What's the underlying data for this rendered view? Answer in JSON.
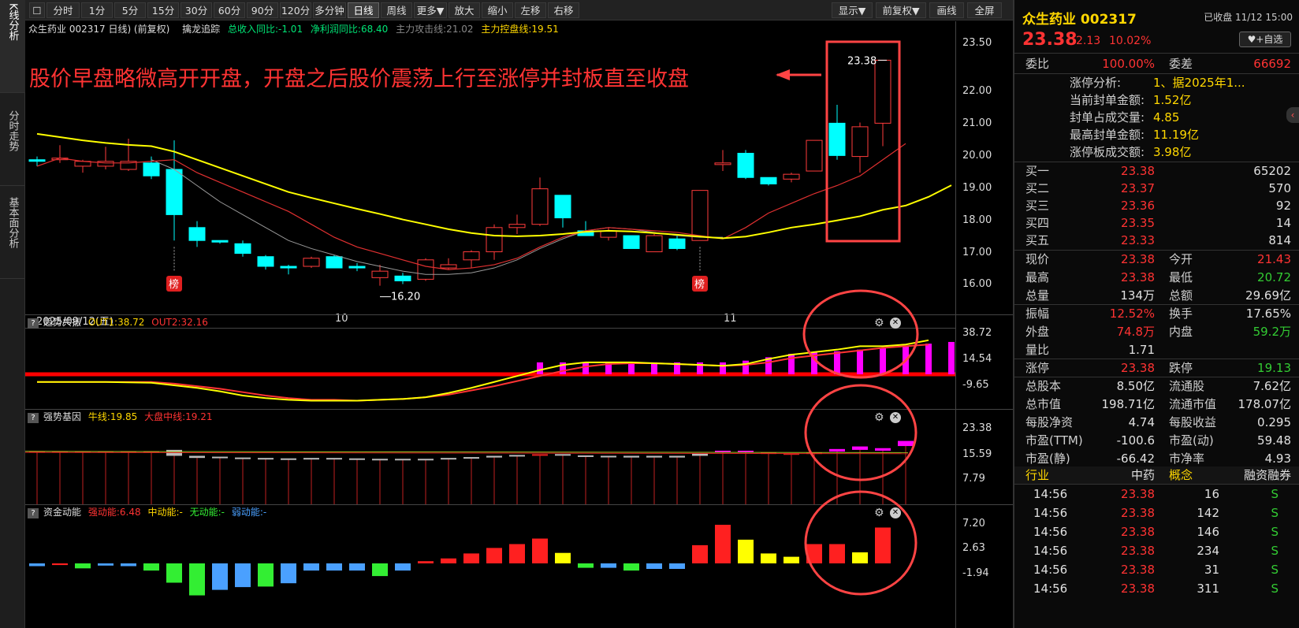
{
  "sidebar": {
    "tabs": [
      "K线分析",
      "分时走势",
      "基本面分析"
    ]
  },
  "toolbar": {
    "checkbox": "☐",
    "periods": [
      "分时",
      "1分",
      "5分",
      "15分",
      "30分",
      "60分",
      "90分",
      "120分",
      "多分钟",
      "日线",
      "周线",
      "更多▼"
    ],
    "actions": [
      "放大",
      "缩小",
      "左移",
      "右移"
    ],
    "right": [
      "显示▼",
      "前复权▼",
      "画线",
      "全屏"
    ],
    "active": "日线"
  },
  "info": {
    "stock": "众生药业 002317 日线) (前复权)",
    "tool": "擒龙追踪",
    "items": [
      {
        "t": "总收入同比:-1.01",
        "c": "#00e676"
      },
      {
        "t": "净利润同比:68.40",
        "c": "#00e676"
      },
      {
        "t": "主力攻击线:21.02",
        "c": "#888888"
      },
      {
        "t": "主力控盘线:19.51",
        "c": "#ffd700"
      }
    ]
  },
  "annotation": "股价早盘略微高开开盘，开盘之后股价震荡上行至涨停并封板直至收盘",
  "date_label": "2025/09/12(五)",
  "month_labels": [
    "10",
    "11"
  ],
  "badge": "榜",
  "price_axis": [
    "23.50",
    "22.00",
    "21.00",
    "20.00",
    "19.00",
    "18.00",
    "17.00",
    "16.00"
  ],
  "chart_data": {
    "type": "candlestick",
    "ylim": [
      16.0,
      23.5
    ],
    "high_label": "23.38",
    "low_label": "16.20",
    "candles": [
      [
        20.3,
        20.4,
        20.1,
        20.25
      ],
      [
        20.3,
        20.75,
        20.2,
        20.35
      ],
      [
        20.1,
        20.3,
        19.9,
        20.25
      ],
      [
        20.1,
        20.7,
        20.0,
        20.25
      ],
      [
        20.0,
        20.95,
        19.95,
        20.25
      ],
      [
        20.2,
        20.4,
        19.7,
        19.8
      ],
      [
        20.0,
        20.9,
        17.8,
        18.6
      ],
      [
        18.2,
        18.4,
        17.6,
        17.8
      ],
      [
        17.8,
        17.8,
        17.7,
        17.75
      ],
      [
        17.7,
        17.8,
        17.3,
        17.4
      ],
      [
        17.3,
        17.35,
        16.9,
        17.0
      ],
      [
        17.0,
        17.05,
        16.75,
        16.95
      ],
      [
        17.0,
        17.3,
        16.95,
        17.25
      ],
      [
        17.3,
        17.35,
        16.95,
        16.95
      ],
      [
        17.0,
        17.1,
        16.85,
        16.95
      ],
      [
        16.65,
        17.05,
        16.4,
        16.85
      ],
      [
        16.7,
        16.8,
        16.45,
        16.55
      ],
      [
        16.6,
        17.25,
        16.55,
        17.2
      ],
      [
        16.95,
        17.25,
        16.9,
        17.05
      ],
      [
        17.2,
        17.5,
        16.95,
        17.45
      ],
      [
        17.45,
        18.3,
        17.2,
        18.2
      ],
      [
        18.2,
        18.6,
        18.0,
        18.3
      ],
      [
        18.3,
        19.75,
        18.25,
        19.4
      ],
      [
        19.2,
        19.2,
        18.2,
        18.5
      ],
      [
        18.1,
        18.4,
        17.95,
        17.95
      ],
      [
        17.9,
        18.2,
        17.8,
        18.1
      ],
      [
        17.95,
        17.95,
        17.55,
        17.55
      ],
      [
        17.45,
        18.0,
        17.45,
        17.95
      ],
      [
        17.85,
        17.95,
        17.5,
        17.55
      ],
      [
        17.8,
        19.35,
        17.8,
        19.35
      ],
      [
        20.15,
        20.6,
        19.95,
        20.2
      ],
      [
        20.5,
        20.6,
        19.7,
        19.75
      ],
      [
        19.75,
        19.75,
        19.5,
        19.55
      ],
      [
        19.7,
        19.9,
        19.6,
        19.85
      ],
      [
        19.95,
        20.9,
        19.95,
        20.9
      ],
      [
        21.43,
        22.0,
        20.3,
        20.43
      ],
      [
        20.4,
        21.45,
        19.9,
        21.32
      ],
      [
        21.43,
        23.38,
        20.72,
        23.38
      ]
    ],
    "ma_red": [
      20.1,
      20.35,
      20.25,
      20.2,
      20.2,
      20.25,
      20.3,
      19.9,
      19.6,
      19.3,
      19.0,
      18.7,
      18.3,
      17.9,
      17.6,
      17.4,
      17.2,
      17.0,
      16.9,
      16.95,
      17.05,
      17.25,
      17.6,
      17.9,
      18.1,
      18.2,
      18.15,
      18.1,
      18.05,
      17.95,
      17.85,
      18.2,
      18.65,
      18.95,
      19.25,
      19.5,
      19.8,
      20.3,
      20.8
    ],
    "ma_gray_start": 5,
    "ma_gray": [
      20.3,
      20.0,
      19.5,
      19.0,
      18.6,
      18.2,
      17.8,
      17.55,
      17.35,
      17.15,
      17.0,
      16.85,
      16.75,
      16.75,
      16.8,
      16.95,
      17.2,
      17.55,
      17.85,
      18.1,
      18.2,
      18.15,
      18.05,
      17.95,
      17.9,
      17.9
    ],
    "ma_yellow": [
      21.1,
      21.0,
      20.9,
      20.82,
      20.76,
      20.72,
      20.55,
      20.3,
      20.05,
      19.8,
      19.55,
      19.3,
      19.12,
      18.95,
      18.78,
      18.62,
      18.45,
      18.3,
      18.15,
      18.03,
      17.95,
      17.93,
      17.95,
      18.0,
      18.07,
      18.1,
      18.08,
      18.03,
      17.98,
      17.92,
      17.87,
      17.92,
      18.05,
      18.2,
      18.3,
      18.42,
      18.55,
      18.75,
      18.88,
      19.15,
      19.51
    ]
  },
  "sub1": {
    "name": "趋势共振",
    "out1": "OUT1:38.72",
    "out2": "OUT2:32.16",
    "axis": [
      "38.72",
      "14.54",
      "-9.65"
    ],
    "out1_vals": [
      -9,
      -9,
      -9,
      -9,
      -9.5,
      -10,
      -13,
      -16,
      -20,
      -25,
      -28,
      -30,
      -31,
      -31,
      -31,
      -30,
      -29,
      -27,
      -22,
      -16,
      -9,
      -2,
      5,
      11,
      14,
      14,
      14,
      13,
      12,
      11,
      10,
      12,
      18,
      23,
      26,
      29,
      33,
      33,
      35,
      40
    ],
    "out2_vals": [
      -9,
      -9,
      -9,
      -9,
      -9,
      -9,
      -11,
      -14,
      -17,
      -21,
      -25,
      -28,
      -30,
      -30,
      -31,
      -30,
      -29,
      -27,
      -24,
      -19,
      -14,
      -8,
      -2,
      4,
      9,
      12,
      13,
      13,
      12,
      11,
      10,
      11,
      14,
      19,
      22,
      25,
      28,
      31,
      33,
      35
    ],
    "bars_from": 22,
    "bars": [
      14,
      14,
      14,
      14,
      14,
      14,
      14,
      14,
      14,
      16,
      20,
      24,
      26,
      27,
      29,
      31,
      33,
      36,
      38
    ]
  },
  "sub2": {
    "name": "强势基因",
    "niu": "牛线:19.85",
    "dapan": "大盘中线:19.21",
    "axis": [
      "23.38",
      "15.59",
      "7.79"
    ],
    "boxes": [
      [
        19.9,
        19.6,
        "r"
      ],
      [
        19.9,
        19.6,
        "r"
      ],
      [
        19.9,
        19.6,
        "r"
      ],
      [
        19.9,
        19.6,
        "r"
      ],
      [
        19.9,
        19.6,
        "r"
      ],
      [
        19.9,
        19.6,
        "r"
      ],
      [
        20.2,
        18.8,
        "w"
      ],
      [
        18.8,
        18.3,
        "w"
      ],
      [
        18.6,
        18.3,
        "w"
      ],
      [
        18.4,
        18.1,
        "w"
      ],
      [
        18.3,
        18.0,
        "w"
      ],
      [
        18.2,
        17.9,
        "w"
      ],
      [
        18.3,
        18.0,
        "w"
      ],
      [
        18.3,
        18.0,
        "w"
      ],
      [
        18.2,
        17.9,
        "w"
      ],
      [
        18.1,
        17.8,
        "w"
      ],
      [
        18.1,
        17.8,
        "w"
      ],
      [
        18.1,
        17.8,
        "w"
      ],
      [
        18.3,
        18.0,
        "w"
      ],
      [
        18.5,
        18.2,
        "w"
      ],
      [
        18.8,
        18.4,
        "w"
      ],
      [
        19.0,
        18.7,
        "w"
      ],
      [
        19.2,
        18.8,
        "r"
      ],
      [
        19.2,
        18.9,
        "w"
      ],
      [
        18.9,
        18.6,
        "w"
      ],
      [
        18.8,
        18.5,
        "w"
      ],
      [
        18.8,
        18.4,
        "w"
      ],
      [
        18.8,
        18.4,
        "w"
      ],
      [
        18.8,
        18.4,
        "w"
      ],
      [
        19.3,
        18.8,
        "w"
      ],
      [
        20.0,
        19.7,
        "m"
      ],
      [
        20.0,
        19.6,
        "m"
      ],
      [
        19.6,
        19.3,
        "r"
      ],
      [
        19.4,
        19.2,
        "r"
      ],
      [
        19.6,
        19.3,
        "r"
      ],
      [
        20.4,
        19.8,
        "m"
      ],
      [
        21.0,
        20.2,
        "m"
      ],
      [
        20.6,
        20.0,
        "m"
      ],
      [
        22.3,
        21.1,
        "m"
      ]
    ]
  },
  "sub3": {
    "name": "资金动能",
    "strong": "强动能:6.48",
    "mid": "中动能:-",
    "none": "无动能:-",
    "weak": "弱动能:-",
    "axis": [
      "7.20",
      "2.63",
      "-1.94"
    ],
    "bars": [
      [
        -0.5,
        "#4aa0ff"
      ],
      [
        -0.3,
        "#ff2020"
      ],
      [
        -0.9,
        "#33ee33"
      ],
      [
        -0.4,
        "#4aa0ff"
      ],
      [
        -0.5,
        "#4aa0ff"
      ],
      [
        -1.3,
        "#33ee33"
      ],
      [
        -3.5,
        "#33ee33"
      ],
      [
        -5.8,
        "#33ee33"
      ],
      [
        -4.8,
        "#4aa0ff"
      ],
      [
        -4.3,
        "#4aa0ff"
      ],
      [
        -4.2,
        "#33ee33"
      ],
      [
        -3.6,
        "#4aa0ff"
      ],
      [
        -1.3,
        "#4aa0ff"
      ],
      [
        -1.3,
        "#4aa0ff"
      ],
      [
        -1.3,
        "#4aa0ff"
      ],
      [
        -2.3,
        "#33ee33"
      ],
      [
        -1.3,
        "#4aa0ff"
      ],
      [
        0.4,
        "#ff2020"
      ],
      [
        0.9,
        "#ff2020"
      ],
      [
        1.8,
        "#ff2020"
      ],
      [
        2.8,
        "#ff2020"
      ],
      [
        3.5,
        "#ff2020"
      ],
      [
        4.5,
        "#ff2020"
      ],
      [
        1.9,
        "#ffff00"
      ],
      [
        -0.8,
        "#33ee33"
      ],
      [
        -0.8,
        "#4aa0ff"
      ],
      [
        -1.3,
        "#33ee33"
      ],
      [
        -1.0,
        "#4aa0ff"
      ],
      [
        -1.0,
        "#4aa0ff"
      ],
      [
        3.3,
        "#ff2020"
      ],
      [
        7.0,
        "#ff2020"
      ],
      [
        4.3,
        "#ffff00"
      ],
      [
        1.8,
        "#ffff00"
      ],
      [
        1.2,
        "#ffff00"
      ],
      [
        3.5,
        "#ff2020"
      ],
      [
        3.5,
        "#ff2020"
      ],
      [
        2.0,
        "#ffff00"
      ],
      [
        6.5,
        "#ff2020"
      ]
    ]
  },
  "right": {
    "name": "众生药业 002317",
    "status": "已收盘 11/12 15:00",
    "price": "23.38",
    "change": "2.13",
    "pct": "10.02%",
    "fav": "+自选",
    "weibi_l": "委比",
    "weibi": "100.00%",
    "weicha_l": "委差",
    "weicha": "66692",
    "zt": [
      {
        "l": "涨停分析:",
        "v": "1、据2025年1..."
      },
      {
        "l": "当前封单金额:",
        "v": "1.52亿"
      },
      {
        "l": "封单占成交量:",
        "v": "4.85"
      },
      {
        "l": "最高封单金额:",
        "v": "11.19亿"
      },
      {
        "l": "涨停板成交额:",
        "v": "3.98亿"
      }
    ],
    "buys": [
      [
        "买一",
        "23.38",
        "65202"
      ],
      [
        "买二",
        "23.37",
        "570"
      ],
      [
        "买三",
        "23.36",
        "92"
      ],
      [
        "买四",
        "23.35",
        "14"
      ],
      [
        "买五",
        "23.33",
        "814"
      ]
    ],
    "q1": [
      [
        "现价",
        "23.38",
        "r",
        "今开",
        "21.43",
        "r"
      ],
      [
        "最高",
        "23.38",
        "r",
        "最低",
        "20.72",
        "g"
      ],
      [
        "总量",
        "134万",
        "w",
        "总额",
        "29.69亿",
        "w"
      ]
    ],
    "q2": [
      [
        "振幅",
        "12.52%",
        "r",
        "换手",
        "17.65%",
        "w"
      ],
      [
        "外盘",
        "74.8万",
        "r",
        "内盘",
        "59.2万",
        "g"
      ],
      [
        "量比",
        "1.71",
        "w",
        "",
        "",
        " w"
      ]
    ],
    "q3": [
      [
        "涨停",
        "23.38",
        "r",
        "跌停",
        "19.13",
        "g"
      ]
    ],
    "q4": [
      [
        "总股本",
        "8.50亿",
        "w",
        "流通股",
        "7.62亿",
        "w"
      ],
      [
        "总市值",
        "198.71亿",
        "w",
        "流通市值",
        "178.07亿",
        "w"
      ],
      [
        "每股净资",
        "4.74",
        "w",
        "每股收益",
        "0.295",
        "w"
      ],
      [
        "市盈(TTM)",
        "-100.6",
        "w",
        "市盈(动)",
        "59.48",
        "w"
      ],
      [
        "市盈(静)",
        "-66.42",
        "w",
        "市净率",
        "4.93",
        "w"
      ]
    ],
    "ind": [
      "行业",
      "中药",
      "概念",
      "融资融券"
    ],
    "trades": [
      [
        "14:56",
        "23.38",
        "16",
        "S"
      ],
      [
        "14:56",
        "23.38",
        "142",
        "S"
      ],
      [
        "14:56",
        "23.38",
        "146",
        "S"
      ],
      [
        "14:56",
        "23.38",
        "234",
        "S"
      ],
      [
        "14:56",
        "23.38",
        "31",
        "S"
      ],
      [
        "14:56",
        "23.38",
        "311",
        "S"
      ]
    ]
  }
}
